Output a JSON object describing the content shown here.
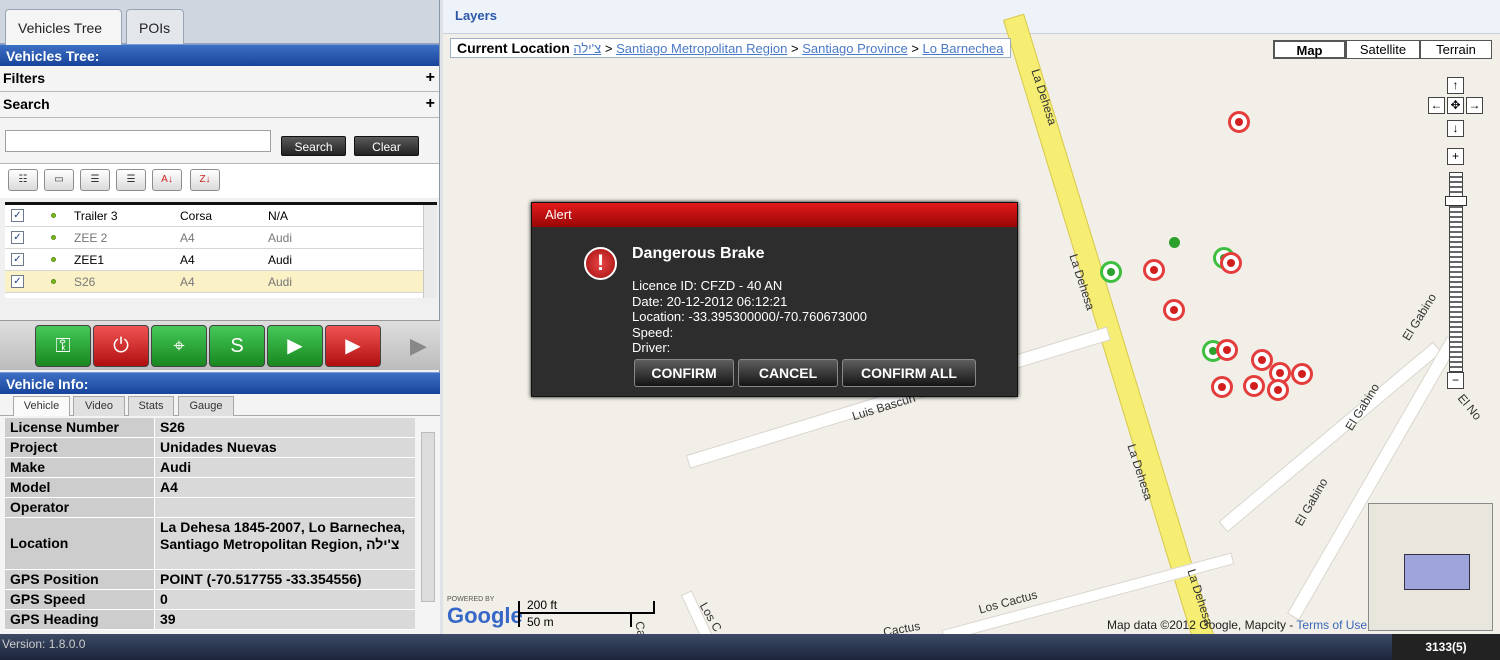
{
  "left_tabs": [
    "Vehicles Tree",
    "POIs"
  ],
  "vehicles_tree_header": "Vehicles Tree:",
  "filters_label": "Filters",
  "search_label": "Search",
  "search_input": {
    "value": "",
    "placeholder": ""
  },
  "search_button": "Search",
  "clear_button": "Clear",
  "vehicle_rows": [
    {
      "name": "Trailer 3",
      "model": "Corsa",
      "make": "N/A",
      "checked": true
    },
    {
      "name": "ZEE 2",
      "model": "A4",
      "make": "Audi",
      "checked": true
    },
    {
      "name": "ZEE1",
      "model": "A4",
      "make": "Audi",
      "checked": true
    },
    {
      "name": "S26",
      "model": "A4",
      "make": "Audi",
      "checked": true
    }
  ],
  "vehicle_info_header": "Vehicle Info:",
  "info_tabs": [
    "Vehicle",
    "Video",
    "Stats",
    "Gauge"
  ],
  "vehicle_info": [
    {
      "key": "License Number",
      "value": "S26"
    },
    {
      "key": "Project",
      "value": "Unidades Nuevas"
    },
    {
      "key": "Make",
      "value": "Audi"
    },
    {
      "key": "Model",
      "value": "A4"
    },
    {
      "key": "Operator",
      "value": ""
    },
    {
      "key": "Location",
      "value": "La Dehesa 1845-2007, Lo Barnechea, Santiago Metropolitan Region, צ'ילה"
    },
    {
      "key": "GPS Position",
      "value": "POINT (-70.517755 -33.354556)"
    },
    {
      "key": "GPS Speed",
      "value": "0"
    },
    {
      "key": "GPS Heading",
      "value": "39"
    }
  ],
  "layers_label": "Layers",
  "breadcrumb": {
    "label": "Current Location",
    "items": [
      "צ'ילה",
      "Santiago Metropolitan Region",
      "Santiago Province",
      "Lo Barnechea"
    ],
    "separator": ">"
  },
  "map_types": [
    "Map",
    "Satellite",
    "Terrain"
  ],
  "road_labels": [
    "La Dehesa",
    "La Dehesa",
    "La Dehesa",
    "La Dehesa",
    "Luis Bascuñ",
    "El Gabino",
    "El Gabino",
    "El Gabino",
    "El No",
    "Los Cactus",
    "Los C",
    "Ca",
    "Cactus"
  ],
  "scale": {
    "top": "200 ft",
    "bottom": "50 m"
  },
  "google_powered": "POWERED BY",
  "google_logo": "Google",
  "map_copyright": "Map data ©2012 Google, Mapcity - ",
  "terms_link": "Terms of Use",
  "alert": {
    "header": "Alert",
    "title": "Dangerous Brake",
    "licence": "Licence ID: CFZD - 40 AN",
    "date": "Date: 20-12-2012 06:12:21",
    "location": "Location: -33.395300000/-70.760673000",
    "speed": "Speed:",
    "driver": "Driver:",
    "confirm": "CONFIRM",
    "cancel": "CANCEL",
    "confirm_all": "CONFIRM  ALL"
  },
  "version": "Version: 1.8.0.0",
  "counter": "3133(5)",
  "colors": {
    "header_blue": "#18449a",
    "alert_red": "#e21a1a",
    "action_green": "#18871e",
    "action_red": "#b10f0f"
  }
}
